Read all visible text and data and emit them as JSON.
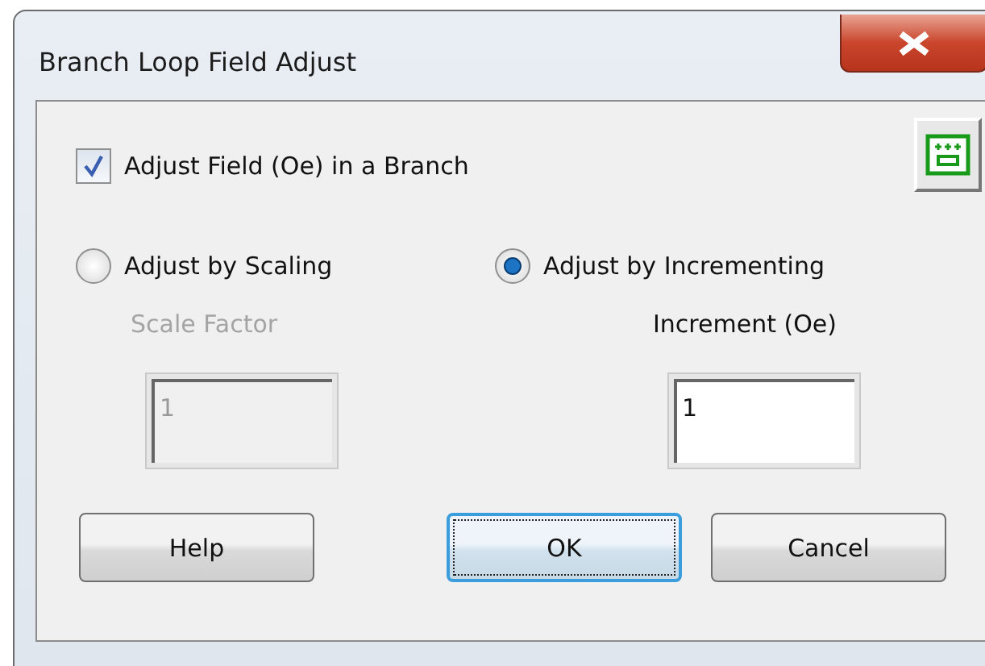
{
  "window": {
    "title": "Branch Loop Field Adjust"
  },
  "branch_checkbox": {
    "label": "Adjust Field (Oe) in a Branch",
    "checked": true
  },
  "options": [
    {
      "label": "Adjust by Scaling",
      "selected": false,
      "field": {
        "label": "Scale Factor",
        "value": "1",
        "disabled": true
      }
    },
    {
      "label": "Adjust by Incrementing",
      "selected": true,
      "field": {
        "label": "Increment (Oe)",
        "value": "1",
        "disabled": false
      }
    }
  ],
  "buttons": [
    {
      "label": "Help",
      "default": false
    },
    {
      "label": "OK",
      "default": true
    },
    {
      "label": "Cancel",
      "default": false
    }
  ]
}
